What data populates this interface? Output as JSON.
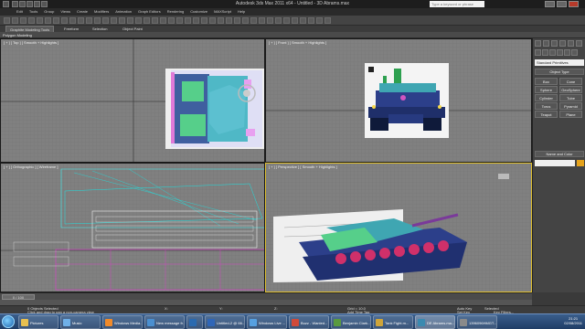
{
  "window": {
    "title": "Autodesk 3ds Max 2011 x64 - Untitled - 3D Abrams.max",
    "search_placeholder": "Type a keyword or phrase"
  },
  "menu": [
    "Edit",
    "Tools",
    "Group",
    "Views",
    "Create",
    "Modifiers",
    "Animation",
    "Graph Editors",
    "Rendering",
    "Customize",
    "MAXScript",
    "Help"
  ],
  "ribbon": {
    "tabs": [
      "Graphite Modeling Tools",
      "Freeform",
      "Selection",
      "Object Paint"
    ],
    "panel_label": "Polygon Modeling"
  },
  "viewports": {
    "top": "[ + ] [ Top ] [ Smooth + Highlights ]",
    "front": "[ + ] [ Front ] [ Smooth + Highlights ]",
    "ortho": "[ + ] [ Orthographic ] [ Wireframe ]",
    "persp": "[ + ] [ Perspective ] [ Smooth + Highlights ]"
  },
  "command_panel": {
    "dropdown": "Standard Primitives",
    "object_type_header": "Object Type",
    "buttons": [
      "Box",
      "Cone",
      "Sphere",
      "GeoSphere",
      "Cylinder",
      "Tube",
      "Torus",
      "Pyramid",
      "Teapot",
      "Plane"
    ],
    "name_color_header": "Name and Color"
  },
  "timeslider": {
    "label": "0 / 100"
  },
  "status": {
    "selected": "0 Objects Selected",
    "hint": "Click and drag to pan a non-camera view",
    "x": "X:",
    "y": "Y:",
    "z": "Z:",
    "grid": "Grid = 10.0",
    "auto_key": "Auto Key",
    "selected_dd": "Selected",
    "set_key": "Set Key",
    "key_filters": "Key Filters...",
    "add_time_tag": "Add Time Tag"
  },
  "taskbar": {
    "items": [
      {
        "label": "Pictures",
        "color": "#e8c050"
      },
      {
        "label": "Music",
        "color": "#6fb0e8"
      },
      {
        "label": "Windows Media...",
        "color": "#f08a2a"
      },
      {
        "label": "New message fr...",
        "color": "#4a8fd0"
      },
      {
        "label": "",
        "color": "#2a6ab0"
      },
      {
        "label": "Untitled-2 @ 66...",
        "color": "#2f66b8"
      },
      {
        "label": "Windows Live ...",
        "color": "#56a0e0"
      },
      {
        "label": "Buzz - Wanted...",
        "color": "#d04a3a"
      },
      {
        "label": "Benjamin Clark...",
        "color": "#5a9a40"
      },
      {
        "label": "Tank Fight.m...",
        "color": "#cfa53a"
      },
      {
        "label": "DE Abrams.ma...",
        "color": "#3a8ab0"
      },
      {
        "label": "1396096HMGT...",
        "color": "#8a8a8a"
      }
    ],
    "time": "21:21",
    "date": "02/08/2011"
  }
}
